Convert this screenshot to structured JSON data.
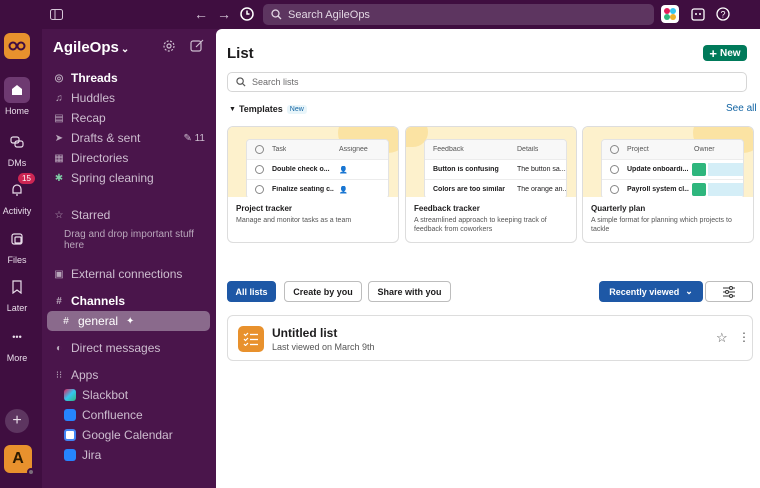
{
  "topbar": {
    "search_placeholder": "Search AgileOps"
  },
  "rail": {
    "items": [
      {
        "label": "Home"
      },
      {
        "label": "DMs"
      },
      {
        "label": "Activity",
        "badge": "15"
      },
      {
        "label": "Files"
      },
      {
        "label": "Later"
      },
      {
        "label": "More"
      }
    ],
    "avatar_letter": "A"
  },
  "sidebar": {
    "workspace": "AgileOps",
    "items": {
      "threads": "Threads",
      "huddles": "Huddles",
      "recap": "Recap",
      "drafts": "Drafts & sent",
      "drafts_count": "11",
      "directories": "Directories",
      "spring": "Spring cleaning",
      "starred": "Starred",
      "starred_hint": "Drag and drop important stuff here",
      "external": "External connections",
      "channels": "Channels",
      "general": "general",
      "direct": "Direct messages",
      "apps": "Apps",
      "slackbot": "Slackbot",
      "confluence": "Confluence",
      "gcal": "Google Calendar",
      "jira": "Jira"
    }
  },
  "main": {
    "title": "List",
    "new_label": "New",
    "search_placeholder": "Search lists",
    "templates_label": "Templates",
    "new_badge": "New",
    "see_all": "See all",
    "templates": [
      {
        "title": "Project tracker",
        "desc": "Manage and monitor tasks as a team",
        "col1": "Task",
        "col2": "Assignee",
        "row1": "Double check o...",
        "row2": "Finalize seating c..."
      },
      {
        "title": "Feedback tracker",
        "desc": "A streamlined approach to keeping track of feedback from coworkers",
        "col1": "Feedback",
        "col2": "Details",
        "row1": "Button is confusing",
        "row1b": "The button sa...",
        "row2": "Colors are too similar",
        "row2b": "The orange an..."
      },
      {
        "title": "Quarterly plan",
        "desc": "A simple format for planning which projects to tackle",
        "col1": "Project",
        "col2": "Owner",
        "row1": "Update onboardi...",
        "row2": "Payroll system cl..."
      }
    ],
    "filters": {
      "all": "All lists",
      "created": "Create by you",
      "shared": "Share with you",
      "sort": "Recently viewed"
    },
    "list_item": {
      "name": "Untitled list",
      "sub": "Last viewed on March 9th"
    }
  },
  "colors": {
    "aubergine": "#4a154b",
    "rail": "#3f0e40",
    "green": "#007a5a",
    "blue": "#1e58a6",
    "orange": "#e8912d"
  }
}
